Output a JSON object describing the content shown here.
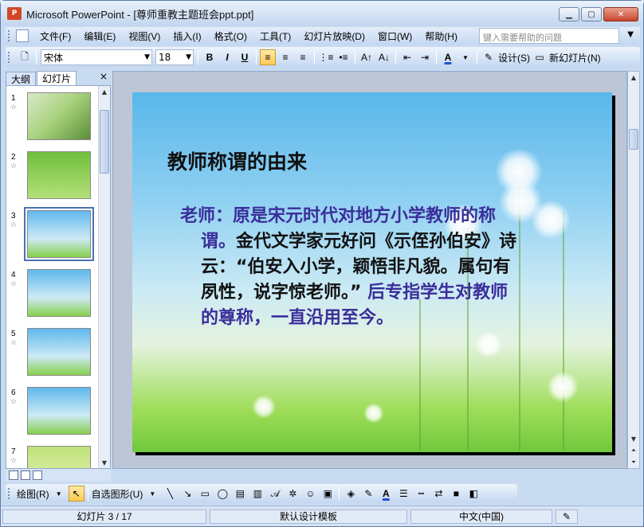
{
  "window": {
    "title": "Microsoft PowerPoint - [尊师重教主题班会ppt.ppt]",
    "app_icon": "powerpoint-icon"
  },
  "menu": {
    "items": [
      "文件(F)",
      "编辑(E)",
      "视图(V)",
      "插入(I)",
      "格式(O)",
      "工具(T)",
      "幻灯片放映(D)",
      "窗口(W)",
      "帮助(H)"
    ],
    "help_placeholder": "键入需要帮助的问题"
  },
  "format_toolbar": {
    "font_name": "宋体",
    "font_size": "18",
    "bold": "B",
    "italic": "I",
    "underline": "U",
    "font_color_label": "A",
    "design_label": "设计(S)",
    "new_slide_label": "新幻灯片(N)"
  },
  "left_tabs": {
    "outline": "大纲",
    "slides": "幻灯片",
    "close": "×"
  },
  "thumbnails": [
    {
      "num": "1",
      "star": "☆"
    },
    {
      "num": "2",
      "star": "☆"
    },
    {
      "num": "3",
      "star": "☆"
    },
    {
      "num": "4",
      "star": "☆"
    },
    {
      "num": "5",
      "star": "☆"
    },
    {
      "num": "6",
      "star": "☆"
    },
    {
      "num": "7",
      "star": "☆"
    }
  ],
  "slide": {
    "title": "教师称谓的由来",
    "body_lead": "老师：原是宋元时代对地方小学教师的称谓。",
    "body_main": "金代文学家元好问《示侄孙伯安》诗云：“伯安入小学，颖悟非凡貌。属句有夙性，说字惊老师。”",
    "body_tail": " 后专指学生对教师的尊称，一直沿用至今。"
  },
  "draw_toolbar": {
    "draw_label": "绘图(R)",
    "autoshape_label": "自选图形(U)"
  },
  "status": {
    "slide_info": "幻灯片 3 / 17",
    "template": "默认设计模板",
    "language": "中文(中国)"
  },
  "colors": {
    "slide_body_highlight": "#3b2e9a",
    "accent_orange": "#ffc953"
  }
}
